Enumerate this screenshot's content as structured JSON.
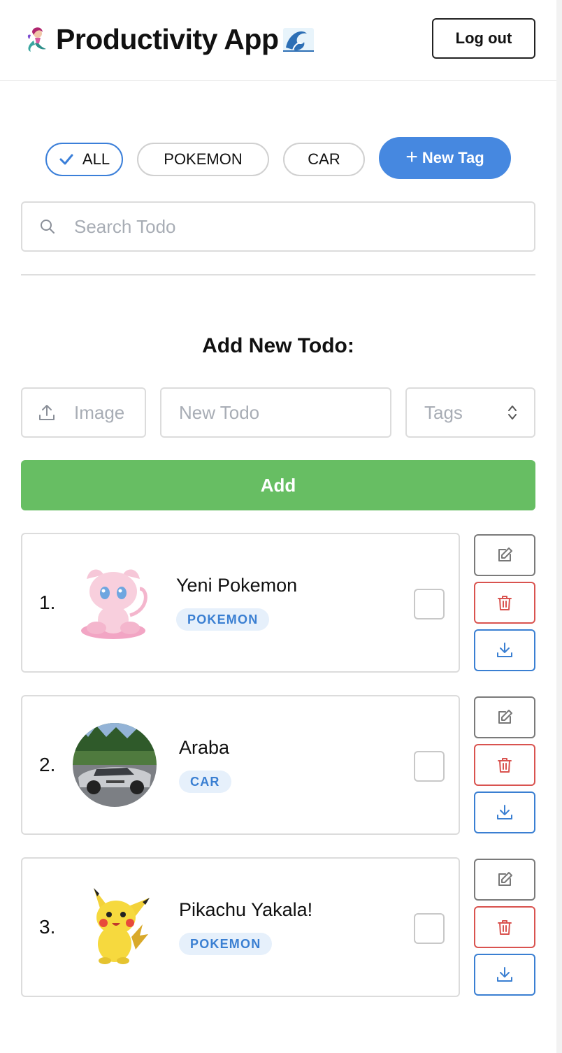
{
  "header": {
    "title": "Productivity App",
    "logout_label": "Log out",
    "left_emoji_icon": "mermaid-icon",
    "right_emoji_icon": "wave-icon"
  },
  "tags": {
    "items": [
      {
        "label": "ALL",
        "selected": true
      },
      {
        "label": "POKEMON",
        "selected": false
      },
      {
        "label": "CAR",
        "selected": false
      }
    ],
    "new_tag_label": "New Tag"
  },
  "search": {
    "placeholder": "Search Todo"
  },
  "add_form": {
    "title": "Add New Todo:",
    "image_placeholder": "Image",
    "todo_placeholder": "New Todo",
    "tags_placeholder": "Tags",
    "add_label": "Add"
  },
  "todos": [
    {
      "number": "1.",
      "title": "Yeni Pokemon",
      "tag": "POKEMON",
      "image": "mew-image",
      "done": false
    },
    {
      "number": "2.",
      "title": "Araba",
      "tag": "CAR",
      "image": "car-image",
      "done": false
    },
    {
      "number": "3.",
      "title": "Pikachu Yakala!",
      "tag": "POKEMON",
      "image": "pikachu-image",
      "done": false
    }
  ],
  "colors": {
    "accent": "#4688e0",
    "add_button": "#67be63",
    "delete": "#d9534f",
    "badge_bg": "#e6f0fb",
    "badge_text": "#3a7fd2"
  }
}
